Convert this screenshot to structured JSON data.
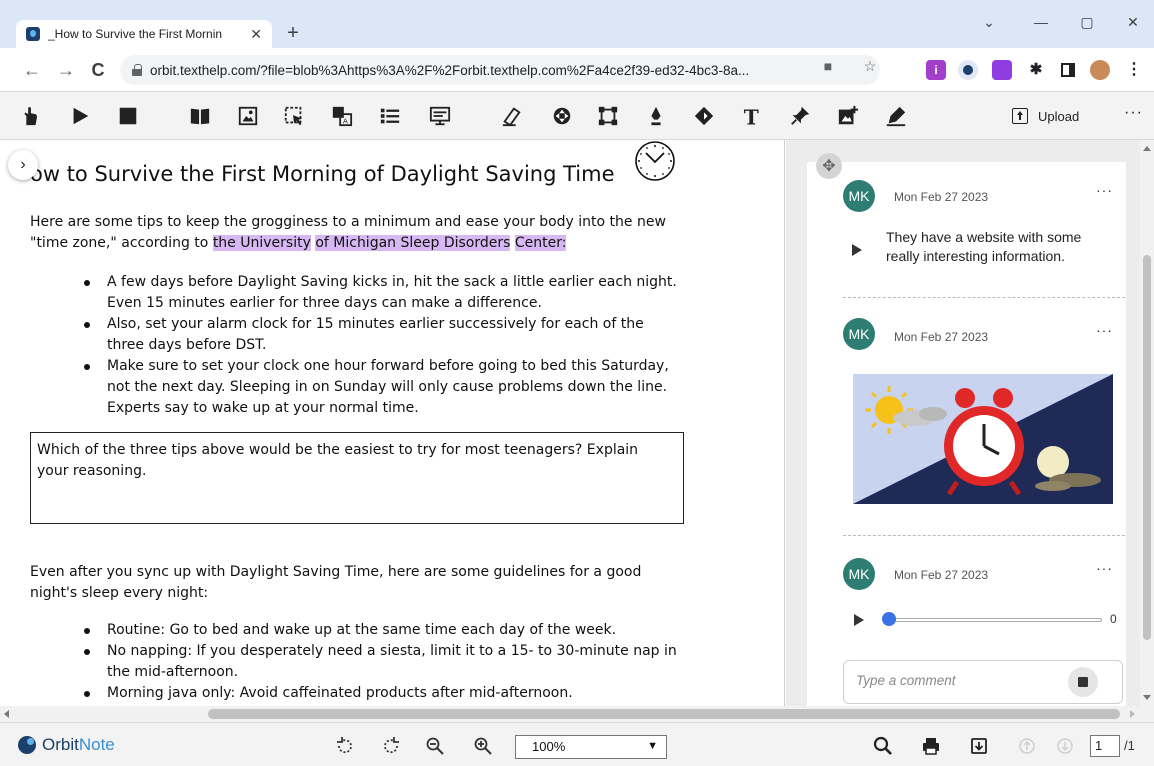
{
  "browser": {
    "tab_title": "_How to Survive the First Mornin",
    "url": "orbit.texthelp.com/?file=blob%3Ahttps%3A%2F%2Forbit.texthelp.com%2Fa4ce2f39-ed32-4bc3-8a..."
  },
  "toolbar": {
    "upload_label": "Upload"
  },
  "document": {
    "title": "ow to Survive the First Morning of Daylight Saving Time",
    "intro_line1": "Here are some tips to keep the grogginess to a minimum and ease your body into the new",
    "intro_line2_pre": "\"time zone,\" according to ",
    "intro_highlight1": "the University",
    "intro_highlight2": "of Michigan Sleep Disorders",
    "intro_highlight3": "Center:",
    "tips": [
      "A few days before Daylight Saving kicks in, hit the sack a little earlier each night.",
      "Even 15 minutes earlier for three days can make a difference.",
      "Also, set your alarm clock for 15 minutes earlier successively for each of the",
      "three days before DST.",
      "Make sure to set your clock one hour forward before going to bed this Saturday,",
      "not the next day. Sleeping in on Sunday will only cause problems down the line.",
      "Experts say to wake up at your normal time."
    ],
    "question_line1": "Which of the three tips above would be the easiest to try for most teenagers?  Explain",
    "question_line2": "your reasoning.",
    "guidelines_line1": "Even after you sync up with Daylight Saving Time, here are some guidelines for a good",
    "guidelines_line2": "night's sleep every night:",
    "guidelines": [
      "Routine: Go to bed and wake up at the same time each day of the week.",
      "No napping: If you desperately need a siesta, limit it to a 15- to 30-minute nap in",
      "the mid-afternoon.",
      "Morning java only: Avoid caffeinated products after mid-afternoon."
    ]
  },
  "comments": [
    {
      "initials": "MK",
      "date": "Mon Feb 27 2023",
      "text_line1": "They have a website with some",
      "text_line2": "really interesting information."
    },
    {
      "initials": "MK",
      "date": "Mon Feb 27 2023",
      "image_icon": "sun-moon-alarm-clock-image"
    },
    {
      "initials": "MK",
      "date": "Mon Feb 27 2023",
      "audio_progress": 0,
      "audio_count": "0"
    }
  ],
  "comment_input": {
    "placeholder": "Type a comment"
  },
  "bottom": {
    "logo_prefix": "Orbit",
    "logo_suffix": "Note",
    "zoom": "100%",
    "page_current": "1",
    "page_total": "/1"
  },
  "colors": {
    "highlight": "#d7b8f3",
    "avatar": "#2e7d73",
    "brand": "#1c3f6b",
    "audio_knob": "#3b72e8"
  }
}
